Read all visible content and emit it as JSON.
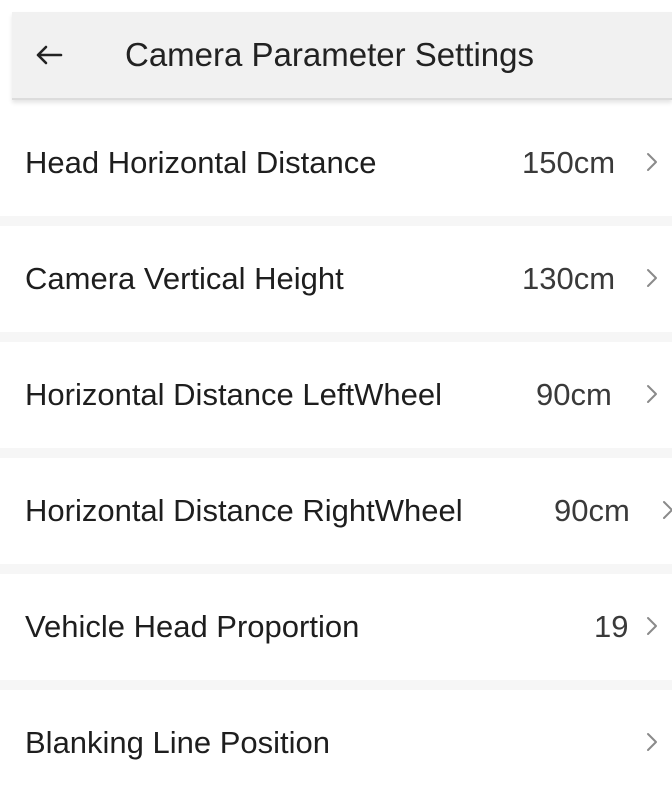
{
  "header": {
    "title": "Camera Parameter Settings",
    "back_icon": "arrow-left-icon"
  },
  "rows": [
    {
      "label": "Head Horizontal Distance",
      "value": "150cm",
      "icon": "chevron-right-icon"
    },
    {
      "label": "Camera Vertical Height",
      "value": "130cm",
      "icon": "chevron-right-icon"
    },
    {
      "label": "Horizontal Distance LeftWheel",
      "value": "90cm",
      "icon": "chevron-right-icon"
    },
    {
      "label": "Horizontal Distance RightWheel",
      "value": "90cm",
      "icon": "chevron-right-icon"
    },
    {
      "label": "Vehicle Head Proportion",
      "value": "19",
      "icon": "chevron-right-icon"
    },
    {
      "label": "Blanking Line Position",
      "value": "",
      "icon": "chevron-right-icon"
    }
  ],
  "colors": {
    "header_bg": "#f1f1f1",
    "page_bg": "#ffffff",
    "text": "#1e1e1e",
    "chevron": "#8a8a8a"
  }
}
